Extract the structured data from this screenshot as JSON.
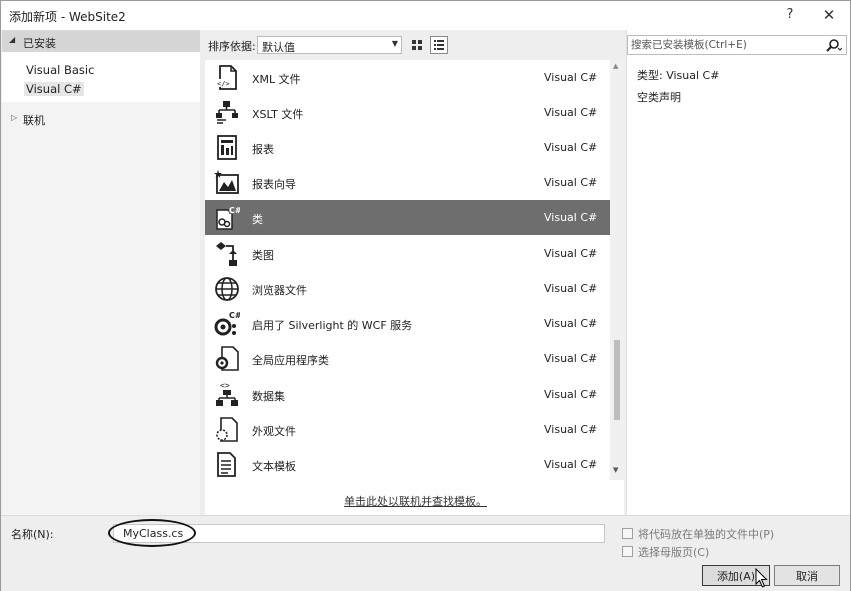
{
  "window": {
    "title": "添加新项 - WebSite2",
    "help_label": "?",
    "close_label": "✕"
  },
  "left": {
    "installed_label": "已安装",
    "installed_items": [
      {
        "label": "Visual Basic",
        "selected": false
      },
      {
        "label": "Visual C#",
        "selected": true
      }
    ],
    "online_label": "联机"
  },
  "sort": {
    "label": "排序依据:",
    "value": "默认值"
  },
  "templates": [
    {
      "name": "XML 文件",
      "lang": "Visual C#",
      "icon": "xml-file-icon"
    },
    {
      "name": "XSLT 文件",
      "lang": "Visual C#",
      "icon": "xslt-file-icon"
    },
    {
      "name": "报表",
      "lang": "Visual C#",
      "icon": "report-icon"
    },
    {
      "name": "报表向导",
      "lang": "Visual C#",
      "icon": "report-wizard-icon"
    },
    {
      "name": "类",
      "lang": "Visual C#",
      "icon": "class-file-icon",
      "selected": true
    },
    {
      "name": "类图",
      "lang": "Visual C#",
      "icon": "class-diagram-icon"
    },
    {
      "name": "浏览器文件",
      "lang": "Visual C#",
      "icon": "browser-file-icon"
    },
    {
      "name": "启用了 Silverlight 的 WCF 服务",
      "lang": "Visual C#",
      "icon": "wcf-service-icon"
    },
    {
      "name": "全局应用程序类",
      "lang": "Visual C#",
      "icon": "global-app-class-icon"
    },
    {
      "name": "数据集",
      "lang": "Visual C#",
      "icon": "dataset-icon"
    },
    {
      "name": "外观文件",
      "lang": "Visual C#",
      "icon": "skin-file-icon"
    },
    {
      "name": "文本模板",
      "lang": "Visual C#",
      "icon": "text-template-icon"
    }
  ],
  "online_link": "单击此处以联机并查找模板。",
  "right": {
    "search_placeholder": "搜索已安装模板(Ctrl+E)",
    "type_text": "类型:  Visual C#",
    "description": "空类声明"
  },
  "bottom": {
    "name_label": "名称(N):",
    "name_value": "MyClass.cs",
    "checkbox1_label": "将代码放在单独的文件中(P)",
    "checkbox2_label": "选择母版页(C)",
    "add_label": "添加(A)",
    "cancel_label": "取消"
  }
}
